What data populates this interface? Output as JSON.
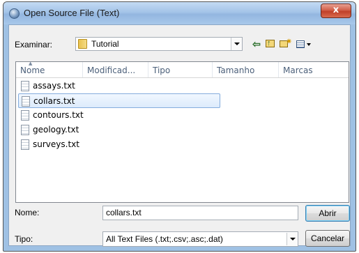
{
  "window": {
    "title": "Open Source File (Text)",
    "close_label": "x"
  },
  "lookin": {
    "label": "Examinar:",
    "value": "Tutorial"
  },
  "columns": [
    "Nome",
    "Modificad...",
    "Tipo",
    "Tamanho",
    "Marcas"
  ],
  "files": [
    {
      "name": "assays.txt"
    },
    {
      "name": "collars.txt",
      "selected": true
    },
    {
      "name": "contours.txt"
    },
    {
      "name": "geology.txt"
    },
    {
      "name": "surveys.txt"
    }
  ],
  "filename": {
    "label": "Nome:",
    "value": "collars.txt"
  },
  "filetype": {
    "label": "Tipo:",
    "value": "All Text Files (.txt;.csv;.asc;.dat)"
  },
  "buttons": {
    "open": "Abrir",
    "cancel": "Cancelar"
  },
  "colors": {
    "title_gradient_top": "#c4dbf4",
    "close_red": "#c0402a",
    "selection_border": "#84acdd"
  }
}
